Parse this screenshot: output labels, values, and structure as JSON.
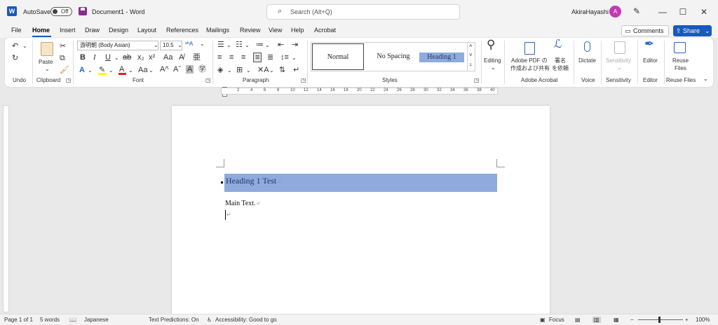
{
  "titlebar": {
    "autosave_label": "AutoSave",
    "autosave_state": "Off",
    "doc_title": "Document1",
    "app_sep": "-",
    "app_name": "Word",
    "search_placeholder": "Search (Alt+Q)",
    "user_name": "AkiraHayashi",
    "avatar_initial": "A"
  },
  "tabs": [
    "File",
    "Home",
    "Insert",
    "Draw",
    "Design",
    "Layout",
    "References",
    "Mailings",
    "Review",
    "View",
    "Help",
    "Acrobat"
  ],
  "active_tab": "Home",
  "comments_label": "Comments",
  "share_label": "Share",
  "ribbon": {
    "undo_group": "Undo",
    "clipboard_group": "Clipboard",
    "paste_label": "Paste",
    "font_group": "Font",
    "font_name": "游明朝 (Body Asian)",
    "font_size": "10.5",
    "paragraph_group": "Paragraph",
    "styles_group": "Styles",
    "style_normal": "Normal",
    "style_nospacing": "No Spacing",
    "style_heading1": "Heading 1",
    "editing_label": "Editing",
    "adobe_pdf_label1": "Adobe PDF の",
    "adobe_pdf_label2": "作成および共有",
    "sign_label1": "署名",
    "sign_label2": "を依頼",
    "adobe_group": "Adobe Acrobat",
    "dictate_label": "Dictate",
    "voice_group": "Voice",
    "sensitivity_label": "Sensitivity",
    "sensitivity_group": "Sensitivity",
    "editor_label": "Editor",
    "editor_group": "Editor",
    "reuse_label1": "Reuse",
    "reuse_label2": "Files",
    "reuse_group": "Reuse Files"
  },
  "ruler_numbers": [
    "2",
    "4",
    "6",
    "8",
    "10",
    "12",
    "14",
    "16",
    "18",
    "20",
    "22",
    "24",
    "26",
    "28",
    "30",
    "32",
    "34",
    "36",
    "38",
    "40"
  ],
  "document": {
    "heading": "Heading 1 Test",
    "body": "Main Text."
  },
  "status": {
    "page": "Page 1 of 1",
    "words": "5 words",
    "language": "Japanese",
    "predictions": "Text Predictions: On",
    "accessibility": "Accessibility: Good to go",
    "focus": "Focus",
    "zoom": "100%"
  }
}
